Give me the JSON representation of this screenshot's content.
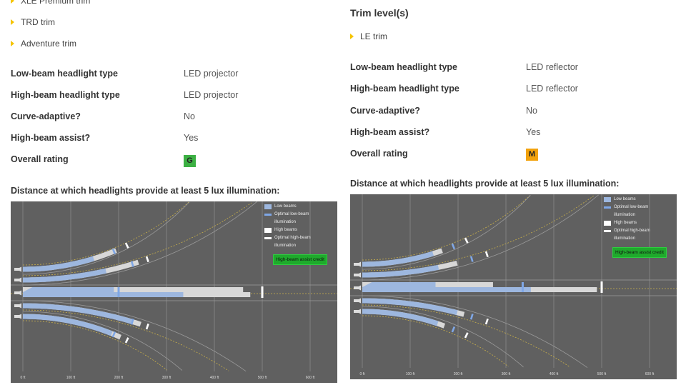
{
  "colors": {
    "low_beam": "#9db7df",
    "optimal_low": "#7fa7e6",
    "high_beam": "#d8d8d8",
    "optimal_high": "#ffffff",
    "road_center": "#c9b04a",
    "road_edge": "#9a9a9a",
    "chart_bg": "#606060",
    "credit": "#1faa2c",
    "rating_good": "#3cb043",
    "rating_marginal": "#f2a20c"
  },
  "left": {
    "trims": [
      "XLE Premium trim",
      "TRD trim",
      "Adventure trim"
    ],
    "rows": [
      {
        "label": "Low-beam headlight type",
        "value": "LED projector"
      },
      {
        "label": "High-beam headlight type",
        "value": "LED projector"
      },
      {
        "label": "Curve-adaptive?",
        "value": "No"
      },
      {
        "label": "High-beam assist?",
        "value": "Yes"
      },
      {
        "label": "Overall rating",
        "value": "G"
      }
    ],
    "distance_heading": "Distance at which headlights provide at least 5 lux illumination:"
  },
  "right": {
    "trim_heading": "Trim level(s)",
    "trims": [
      "LE trim"
    ],
    "rows": [
      {
        "label": "Low-beam headlight type",
        "value": "LED reflector"
      },
      {
        "label": "High-beam headlight type",
        "value": "LED reflector"
      },
      {
        "label": "Curve-adaptive?",
        "value": "No"
      },
      {
        "label": "High-beam assist?",
        "value": "Yes"
      },
      {
        "label": "Overall rating",
        "value": "M"
      }
    ],
    "distance_heading": "Distance at which headlights provide at least 5 lux illumination:"
  },
  "legend": {
    "low": "Low beams",
    "optimal_low": "Optimal low-beam illumination",
    "high": "High beams",
    "optimal_high": "Optimal high-beam illumination",
    "credit": "High-beam assist credit"
  },
  "chart_data": [
    {
      "type": "diagram",
      "x_ticks": [
        "0 ft",
        "100 ft",
        "200 ft",
        "300 ft",
        "400 ft",
        "500 ft",
        "600 ft"
      ],
      "curves": [
        {
          "direction": "left",
          "radius_ft": 500,
          "low_ft": 150,
          "high_ft": 200,
          "optimal_low_ft": 195,
          "optimal_high_ft": 225
        },
        {
          "direction": "left",
          "radius_ft": 800,
          "low_ft": 175,
          "high_ft": 245,
          "optimal_low_ft": 232,
          "optimal_high_ft": 265
        },
        {
          "direction": "right",
          "radius_ft": 800,
          "low_ft": 230,
          "high_ft": 250,
          "optimal_low_ft": 232,
          "optimal_high_ft": 265
        },
        {
          "direction": "right",
          "radius_ft": 500,
          "low_ft": 190,
          "high_ft": 210,
          "optimal_low_ft": 195,
          "optimal_high_ft": 225
        }
      ],
      "straight": {
        "left_lane_low_ft": 190,
        "left_lane_high_ft": 460,
        "right_lane_low_ft": 335,
        "right_lane_high_ft": 475,
        "optimal_low_ft": 200,
        "optimal_high_ft": 500
      }
    },
    {
      "type": "diagram",
      "x_ticks": [
        "0 ft",
        "100 ft",
        "200 ft",
        "300 ft",
        "400 ft",
        "500 ft",
        "600 ft"
      ],
      "curves": [
        {
          "direction": "left",
          "radius_ft": 500,
          "low_ft": 150,
          "high_ft": 170,
          "optimal_low_ft": 195,
          "optimal_high_ft": 225
        },
        {
          "direction": "left",
          "radius_ft": 800,
          "low_ft": 160,
          "high_ft": 200,
          "optimal_low_ft": 232,
          "optimal_high_ft": 265
        },
        {
          "direction": "right",
          "radius_ft": 800,
          "low_ft": 200,
          "high_ft": 215,
          "optimal_low_ft": 232,
          "optimal_high_ft": 265
        },
        {
          "direction": "right",
          "radius_ft": 500,
          "low_ft": 160,
          "high_ft": 175,
          "optimal_low_ft": 195,
          "optimal_high_ft": 225
        }
      ],
      "straight": {
        "left_lane_low_ft": 153,
        "left_lane_high_ft": 273,
        "right_lane_low_ft": 352,
        "right_lane_high_ft": 490,
        "optimal_low_ft": 335,
        "optimal_high_ft": 500
      }
    }
  ]
}
